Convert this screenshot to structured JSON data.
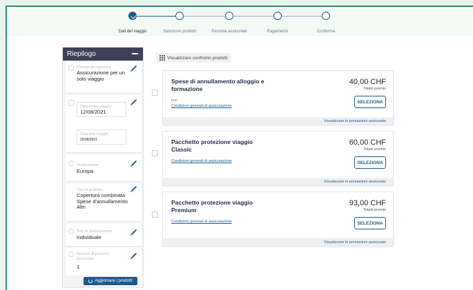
{
  "stepper": {
    "steps": [
      {
        "label": "Dati del viaggio",
        "state": "done"
      },
      {
        "label": "Selezione prodotti",
        "state": "current"
      },
      {
        "label": "Persone assicurate",
        "state": "todo"
      },
      {
        "label": "Pagamento",
        "state": "todo"
      },
      {
        "label": "Conferma",
        "state": "todo"
      }
    ]
  },
  "sidebar": {
    "title": "Riepilogo",
    "coverage": {
      "caption": "Periodo di copertura",
      "value": "Assicurazione per un solo viaggio"
    },
    "start_date": {
      "caption": "Data inizio viaggio",
      "value": "12/08/2021"
    },
    "end_date": {
      "caption": "Data fine viaggio",
      "value": "26/08/2021"
    },
    "destination": {
      "caption": "Destinazione",
      "value": "Europa"
    },
    "product_type": {
      "caption": "Tipo di prodotto",
      "value": "Copertura combinata Spese d'annullamento Altri"
    },
    "insurance_type": {
      "caption": "Tipo di assicurazione",
      "value": "Individuale"
    },
    "persons": {
      "caption": "Numero di persone assicurate",
      "value": "1"
    },
    "update_button": "Aggiornare i prodotti"
  },
  "compare_label": "Visualizzare confronto prodotti",
  "products": [
    {
      "title": "Spese di annullamento alloggio e formazione",
      "note": "test",
      "link": "Condizioni generali di assicurazione",
      "price": "40,00 CHF",
      "price_caption": "Totale premio",
      "select": "SELEZIONA",
      "footer": "Visualizzare le prestazioni assicurate"
    },
    {
      "title": "Pacchetto protezione viaggio Classic",
      "note": "",
      "link": "Condizioni generali di assicurazione",
      "price": "60,00 CHF",
      "price_caption": "Totale premio",
      "select": "SELEZIONA",
      "footer": "Visualizzare le prestazioni assicurate"
    },
    {
      "title": "Pacchetto protezione viaggio Premium",
      "note": "",
      "link": "Condizioni generali di assicurazione",
      "price": "93,00 CHF",
      "price_caption": "Totale premio",
      "select": "SELEZIONA",
      "footer": "Visualizzare le prestazioni assicurate"
    }
  ],
  "colors": {
    "primary": "#1c5a8c",
    "sidebar_header": "#3e4159",
    "frame": "#2b8a7e"
  }
}
